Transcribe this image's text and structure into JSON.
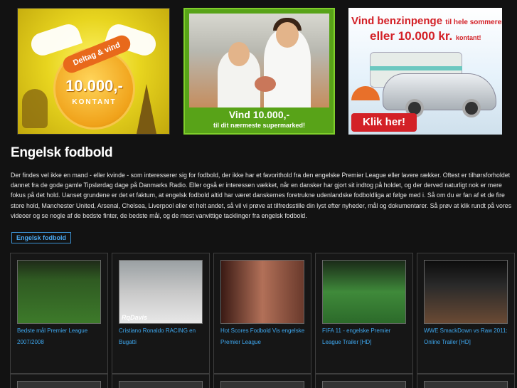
{
  "banners": [
    {
      "ribbon": "Deltag & vind",
      "amount": "10.000,-",
      "sub": "KONTANT"
    },
    {
      "caption": "Vind 10.000,-",
      "sub": "til dit nærmeste supermarked!"
    },
    {
      "line1": "Vind benzinpenge",
      "line1_small": "til hele sommeren",
      "line2": "eller 10.000 kr.",
      "line2_small": "kontant!",
      "cta": "Klik her!"
    }
  ],
  "page": {
    "title": "Engelsk fodbold",
    "intro": "Der findes vel ikke en mand - eller kvinde - som interesserer sig for fodbold, der ikke har et favorithold fra den engelske Premier League eller lavere rækker. Oftest er tilhørsforholdet dannet fra de gode gamle Tipslørdag dage på Danmarks Radio. Eller også er interessen vækket, når en dansker har gjort sit indtog på holdet, og der derved naturligt nok er mere fokus på det hold. Uanset grundene er det et faktum, at engelsk fodbold altid har været danskernes foretrukne udenlandske fodboldliga at følge med i. Så om du er fan af et de fire store hold, Manchester United, Arsenal, Chelsea, Liverpool eller et helt andet, så vil vi prøve at tilfredsstille din lyst efter nyheder, mål og dokumentarer. Så prøv at klik rundt på vores videoer og se nogle af de bedste finter, de bedste mål, og de mest vanvittige tacklinger fra engelsk fodbold.",
    "tag": "Engelsk fodbold"
  },
  "videos": [
    {
      "title": "Bedste mål Premier League 2007/2008"
    },
    {
      "title": "Cristiano Ronaldo RACING en Bugatti",
      "watermark": "RqDavis"
    },
    {
      "title": "Hot Scores Fodbold Vis engelske Premier League"
    },
    {
      "title": "FIFA 11 - engelske Premier League Trailer [HD]"
    },
    {
      "title": "WWE SmackDown vs Raw 2011: Online Trailer [HD]"
    }
  ]
}
